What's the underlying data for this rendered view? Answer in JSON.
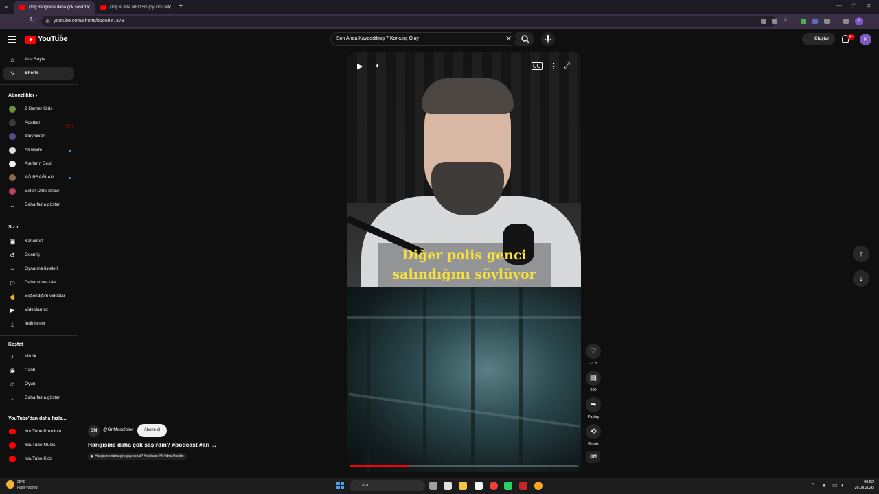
{
  "browser": {
    "tabs": [
      {
        "title": "(10) Hangisine daha çok şaşırd"
      },
      {
        "title": "(10) NUBIA NEO 5G (oyuncu te"
      }
    ],
    "url": "youtube.com/shorts/b6o5hY7378"
  },
  "header": {
    "logo_text": "YouTube",
    "logo_country": "TR",
    "search_value": "Son Anda Kaydedilmiş 7 Korkunç Olay",
    "create_label": "Oluştur",
    "notifications_badge": "9+",
    "avatar_letter": "K"
  },
  "sidebar": {
    "main": [
      {
        "label": "Ana Sayfa",
        "icon": "home-icon"
      },
      {
        "label": "Shorts",
        "icon": "shorts-icon"
      }
    ],
    "subscriptions_title": "Abonelikler",
    "subscriptions": [
      {
        "label": "2 Gamer Girls",
        "color": "#6c8f3a"
      },
      {
        "label": "Adanalı",
        "color": "#3a3a3a"
      },
      {
        "label": "Aleymixed",
        "color": "#5a4a8a"
      },
      {
        "label": "Ali Biçim",
        "color": "#dddddd"
      },
      {
        "label": "Asırların Sesi",
        "color": "#f0f0f0"
      },
      {
        "label": "AĞIRSAĞLAM",
        "color": "#8a6a4a"
      },
      {
        "label": "Balon Date Show",
        "color": "#c04060"
      }
    ],
    "subs_more": "Daha fazla göster",
    "you_title": "Siz",
    "you_items": [
      {
        "label": "Kanalınız",
        "icon": "channel-icon"
      },
      {
        "label": "Geçmiş",
        "icon": "history-icon"
      },
      {
        "label": "Oynatma listeleri",
        "icon": "playlist-icon"
      },
      {
        "label": "Daha sonra izle",
        "icon": "clock-icon"
      },
      {
        "label": "Beğendiğim videolar",
        "icon": "thumbs-up-icon"
      },
      {
        "label": "Videolarınız",
        "icon": "video-icon"
      },
      {
        "label": "İndirilenler",
        "icon": "download-icon"
      }
    ],
    "explore_title": "Keşfet",
    "explore_items": [
      {
        "label": "Müzik",
        "icon": "music-icon"
      },
      {
        "label": "Canlı",
        "icon": "live-icon"
      },
      {
        "label": "Oyun",
        "icon": "game-icon"
      }
    ],
    "explore_more": "Daha fazla göster",
    "more_title": "YouTube'dan daha fazla...",
    "more_items": [
      {
        "label": "YouTube Premium"
      },
      {
        "label": "YouTube Music"
      },
      {
        "label": "YouTube Kids"
      }
    ]
  },
  "video": {
    "caption_line1": "Diğer polis genci",
    "caption_line2": "salındığını söylüyor",
    "progress": 0.26
  },
  "actions": {
    "likes": "23 B",
    "comments": "209",
    "share": "Paylaş",
    "remix": "Remix",
    "channel_badge": "GM"
  },
  "channel": {
    "avatar": "GM",
    "handle": "@GriMeseleler",
    "subscribe": "Abone ol",
    "title": "Hangisine daha çok şaşırdın? #podcast #arı ...",
    "tags": "▶ Hangisine daha çok şaşırdınız? #podcast #fil #dna #keşfet"
  },
  "taskbar": {
    "temp": "25°C",
    "weather": "Hafif yağmur",
    "search": "Ara",
    "time": "09:52",
    "date": "26.08.2026"
  }
}
